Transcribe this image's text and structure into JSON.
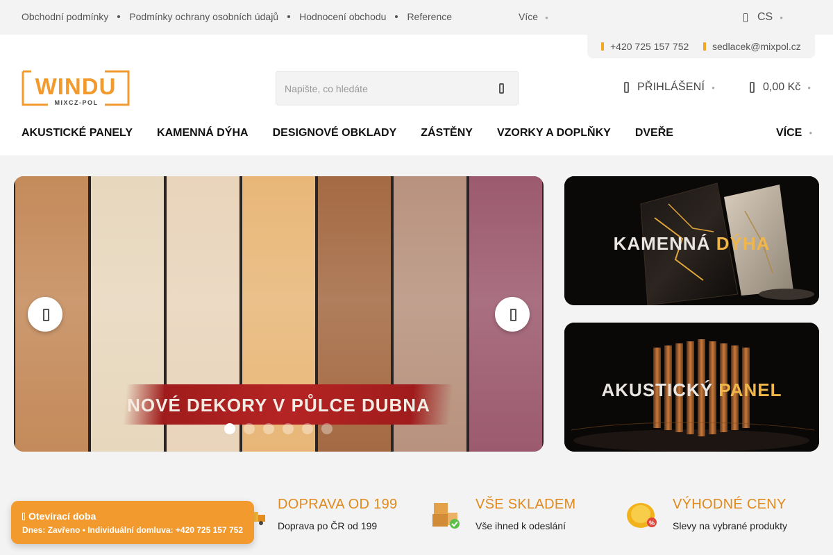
{
  "topbar": {
    "links": [
      "Obchodní podmínky",
      "Podmínky ochrany osobních údajů",
      "Hodnocení obchodu",
      "Reference"
    ],
    "more_label": "Více",
    "language": "CS"
  },
  "contact": {
    "phone": "+420 725 157 752",
    "email": "sedlacek@mixpol.cz"
  },
  "header": {
    "logo_text": "WINDU",
    "logo_subtext": "MIXCZ-POL",
    "search_placeholder": "Napište, co hledáte",
    "login_label": "PŘIHLÁŠENÍ",
    "cart_total": "0,00 Kč"
  },
  "nav": {
    "items": [
      "AKUSTICKÉ PANELY",
      "KAMENNÁ DÝHA",
      "DESIGNOVÉ OBKLADY",
      "ZÁSTĚNY",
      "VZORKY A DOPLŇKY",
      "DVEŘE"
    ],
    "more_label": "VÍCE"
  },
  "slider": {
    "caption": "NOVÉ DEKORY V PŮLCE DUBNA",
    "slide_count": 6,
    "active_slide": 1,
    "plank_colors": [
      "#c48a5a",
      "#e7d7bd",
      "#e9d4bb",
      "#e8b778",
      "#a46a43",
      "#b8927e",
      "#9c5a6e"
    ]
  },
  "banners": [
    {
      "word1": "KAMENNÁ",
      "word2": "DÝHA"
    },
    {
      "word1": "AKUSTICKÝ",
      "word2": "PANEL"
    }
  ],
  "benefits": [
    {
      "title": "DOPRAVA OD 199",
      "text": "Doprava po ČR od 199",
      "icon": "truck-icon"
    },
    {
      "title": "VŠE SKLADEM",
      "text": "Vše ihned k odeslání",
      "icon": "boxes-icon"
    },
    {
      "title": "VÝHODNÉ CENY",
      "text": "Slevy na vybrané produkty",
      "icon": "coin-icon"
    }
  ],
  "hours": {
    "title": "Otevírací doba",
    "text": "Dnes: Zavřeno • Individuální domluva: +420 725 157 752"
  },
  "colors": {
    "accent": "#f29a2e",
    "benefit_title": "#e08a1e",
    "topbar_bg": "#f3f3f3"
  }
}
